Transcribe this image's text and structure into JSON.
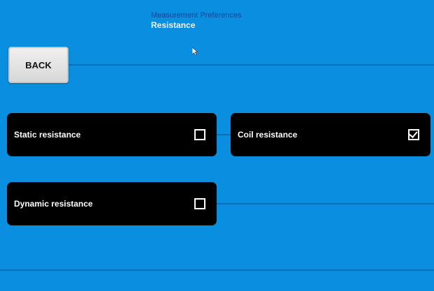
{
  "header": {
    "title": "Measurement Preferences",
    "subtitle": "Resistance"
  },
  "toolbar": {
    "back_label": "BACK"
  },
  "options": [
    {
      "label": "Static resistance",
      "checked": false
    },
    {
      "label": "Coil resistance",
      "checked": true
    },
    {
      "label": "Dynamic resistance",
      "checked": false
    }
  ],
  "colors": {
    "background": "#0a8ee0",
    "option_background": "#000000",
    "option_text": "#ffffff",
    "divider": "#0a6fb6"
  }
}
